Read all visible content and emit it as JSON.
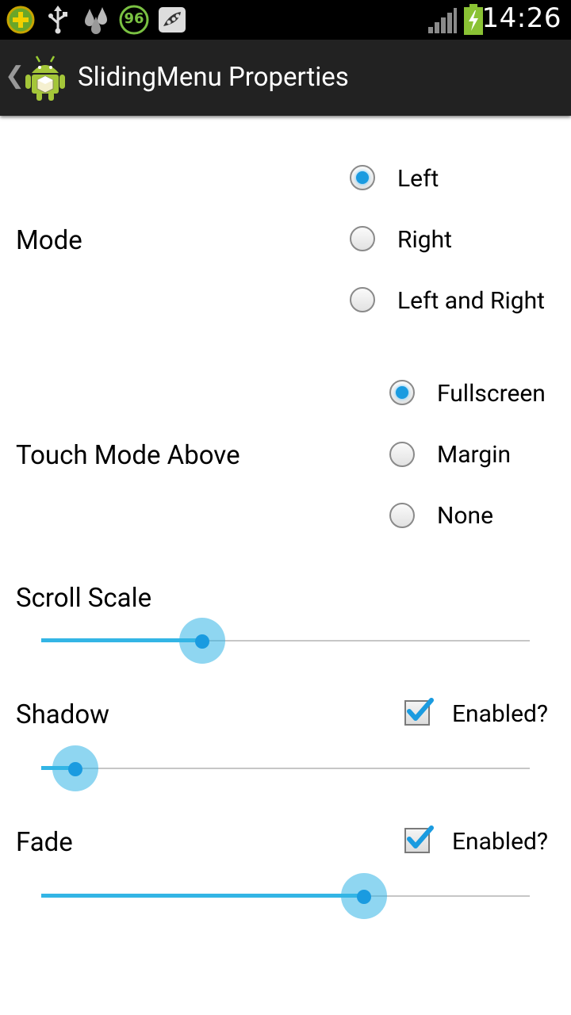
{
  "status_bar": {
    "time": "14:26",
    "icons": [
      "plus-app-icon",
      "usb-icon",
      "drops-icon",
      "battery-saver-96-icon",
      "peas-icon"
    ],
    "badge_text": "96"
  },
  "action_bar": {
    "title": "SlidingMenu Properties"
  },
  "mode": {
    "label": "Mode",
    "options": [
      "Left",
      "Right",
      "Left and Right"
    ],
    "selected": "Left"
  },
  "touch_mode": {
    "label": "Touch Mode Above",
    "options": [
      "Fullscreen",
      "Margin",
      "None"
    ],
    "selected": "Fullscreen"
  },
  "scroll_scale": {
    "label": "Scroll Scale",
    "value": 0.33
  },
  "shadow": {
    "label": "Shadow",
    "checkbox_label": "Enabled?",
    "checked": true,
    "value": 0.07
  },
  "fade": {
    "label": "Fade",
    "checkbox_label": "Enabled?",
    "checked": true,
    "value": 0.66
  },
  "colors": {
    "accent": "#33b5e5",
    "action_bar": "#222222"
  }
}
